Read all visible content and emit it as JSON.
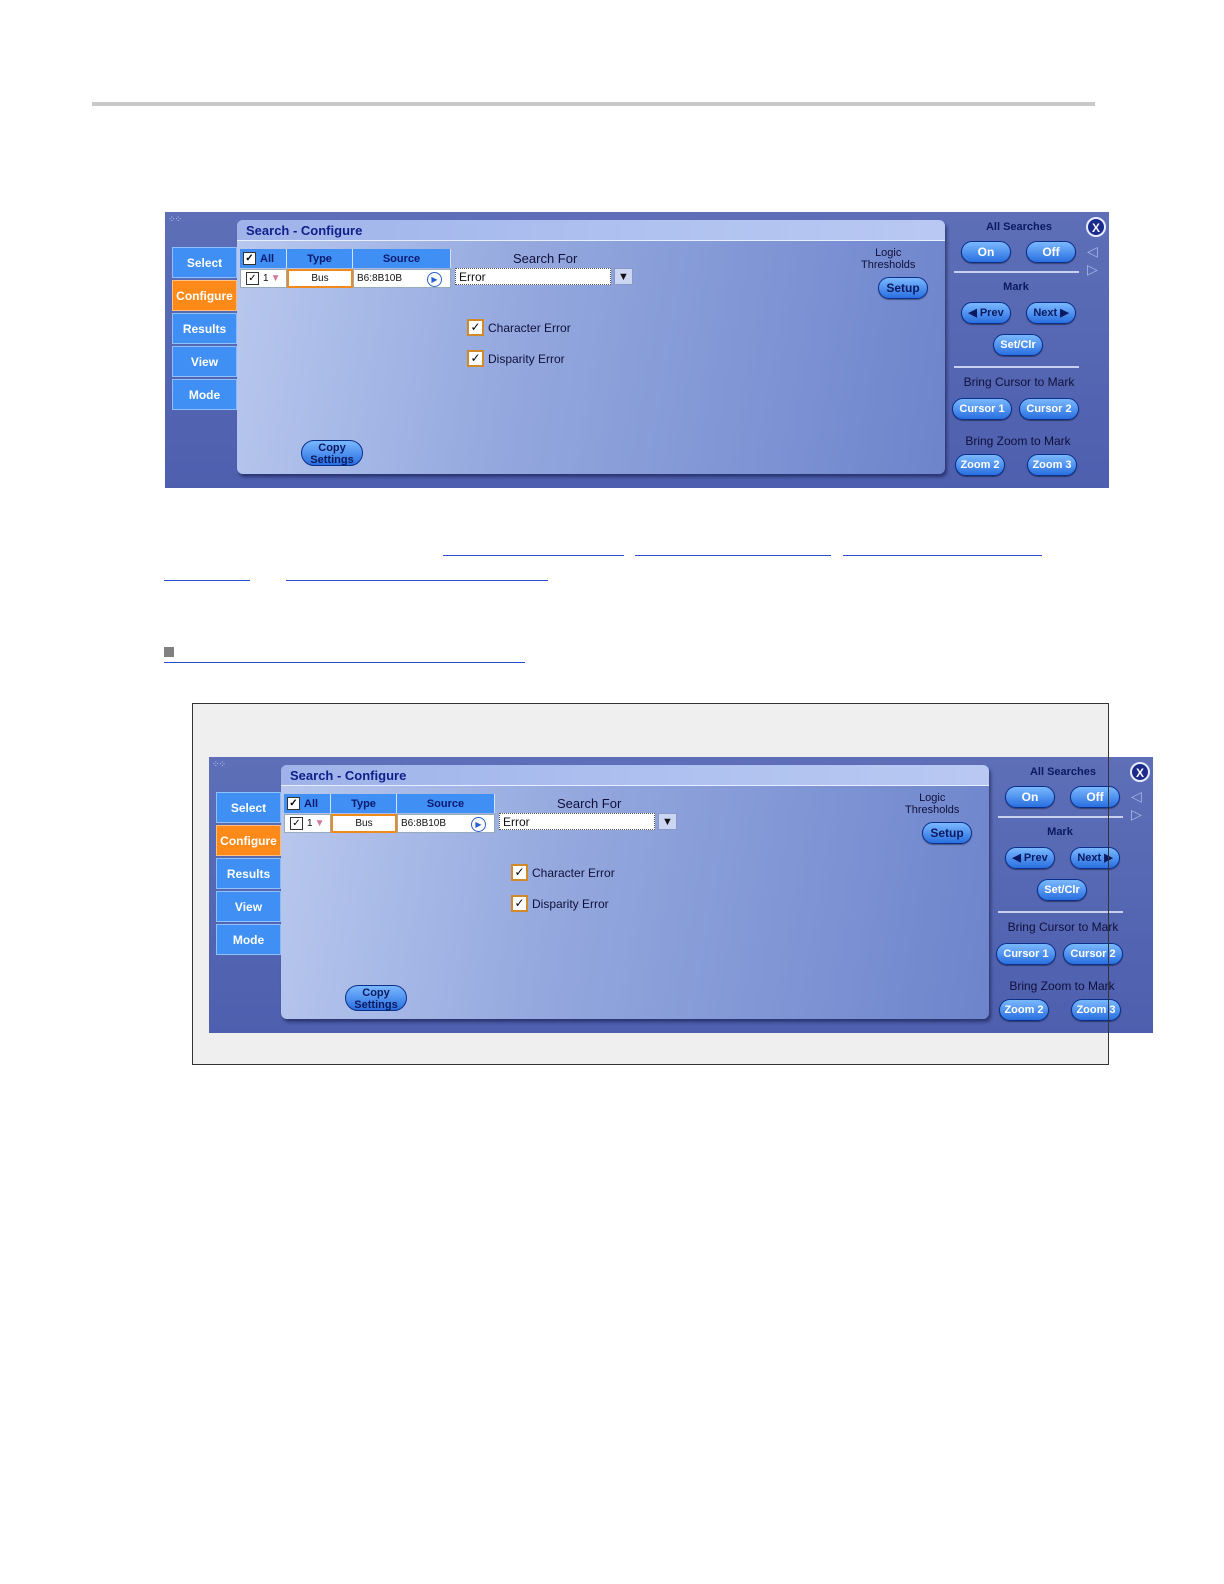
{
  "panel": {
    "title": "Search - Configure",
    "tabs": [
      "Select",
      "Configure",
      "Results",
      "View",
      "Mode"
    ],
    "active_tab": "Configure",
    "table": {
      "headers": {
        "all": "All",
        "type": "Type",
        "source": "Source"
      },
      "row": {
        "index": "1",
        "type": "Bus",
        "source": "B6:8B10B"
      }
    },
    "search_for": {
      "label": "Search For",
      "value": "Error"
    },
    "options": [
      "Character Error",
      "Disparity Error"
    ],
    "logic_thresholds": {
      "line1": "Logic",
      "line2": "Thresholds",
      "button": "Setup"
    },
    "copy_settings": {
      "line1": "Copy",
      "line2": "Settings"
    },
    "sidebar": {
      "all_searches": "All Searches",
      "on": "On",
      "off": "Off",
      "mark": "Mark",
      "prev": "◀ Prev",
      "next": "Next ▶",
      "setclr": "Set/Clr",
      "bring_cursor": "Bring Cursor to Mark",
      "cursor1": "Cursor 1",
      "cursor2": "Cursor 2",
      "bring_zoom": "Bring Zoom to Mark",
      "zoom2": "Zoom 2",
      "zoom3": "Zoom 3",
      "close": "X"
    }
  },
  "colors": {
    "panel_bg": "#5e6fb8",
    "tab": "#3f8ff4",
    "tab_active": "#ff8a1a",
    "button": "#2a6fe0",
    "link": "#2b4bd0"
  }
}
